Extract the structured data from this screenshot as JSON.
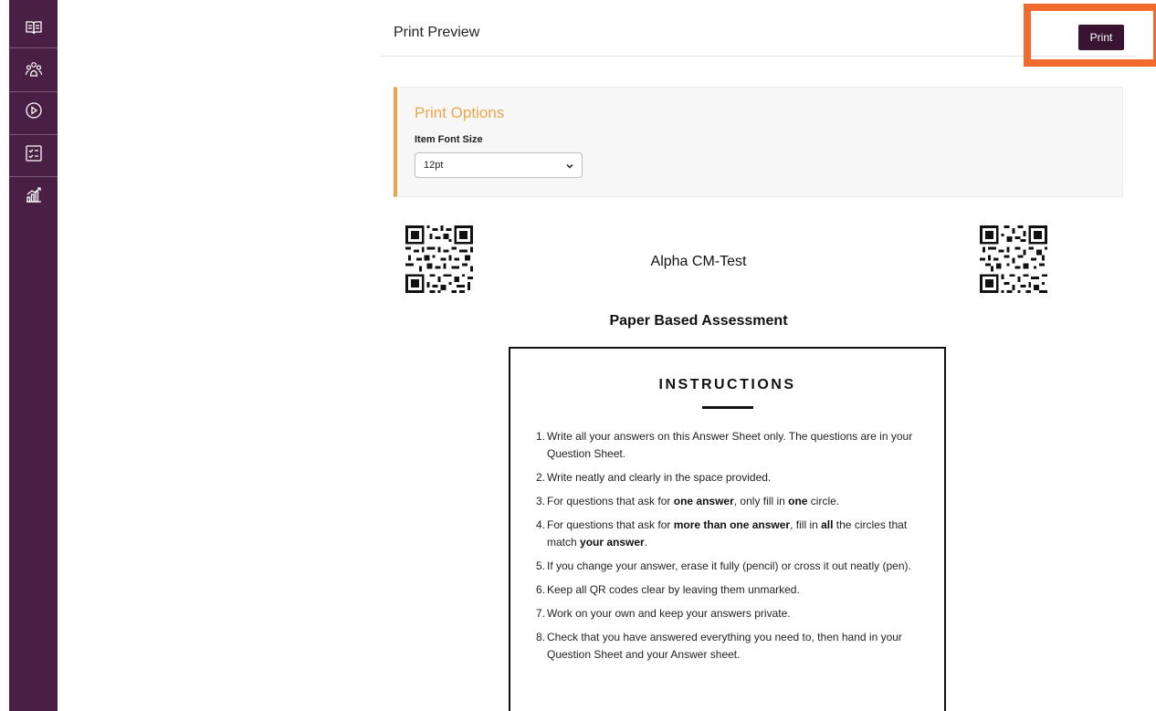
{
  "header": {
    "title": "Print Preview",
    "print_label": "Print"
  },
  "sidebar": {
    "items": [
      {
        "icon": "book-icon"
      },
      {
        "icon": "users-icon"
      },
      {
        "icon": "play-icon"
      },
      {
        "icon": "checklist-icon"
      },
      {
        "icon": "analytics-icon"
      }
    ],
    "color": "#4a1f45"
  },
  "print_options": {
    "title": "Print Options",
    "font_size_label": "Item Font Size",
    "font_size_value": "12pt",
    "accent_color": "#eba64a"
  },
  "document": {
    "title": "Alpha CM-Test",
    "subtitle": "Paper Based Assessment",
    "instructions_heading": "INSTRUCTIONS",
    "instructions": [
      {
        "num": "1.",
        "parts": [
          "Write all your answers on this Answer Sheet only. The questions are in your Question Sheet."
        ]
      },
      {
        "num": "2.",
        "parts": [
          "Write neatly and clearly in the space provided."
        ]
      },
      {
        "num": "3.",
        "parts": [
          "For questions that ask for ",
          "one answer",
          ", only fill in ",
          "one",
          " circle."
        ]
      },
      {
        "num": "4.",
        "parts": [
          "For questions that ask for ",
          "more than one answer",
          ", fill in ",
          "all",
          " the circles that match ",
          "your answer",
          "."
        ]
      },
      {
        "num": "5.",
        "parts": [
          "If you change your answer, erase it fully (pencil) or cross it out neatly (pen)."
        ]
      },
      {
        "num": "6.",
        "parts": [
          "Keep all QR codes clear by leaving them unmarked."
        ]
      },
      {
        "num": "7.",
        "parts": [
          "Work on your own and keep your answers private."
        ]
      },
      {
        "num": "8.",
        "parts": [
          "Check that you have answered everything you need to, then hand in your Question Sheet and your Answer sheet."
        ]
      }
    ]
  },
  "colors": {
    "print_button": "#3a1333",
    "highlight": "#f26b2d"
  }
}
